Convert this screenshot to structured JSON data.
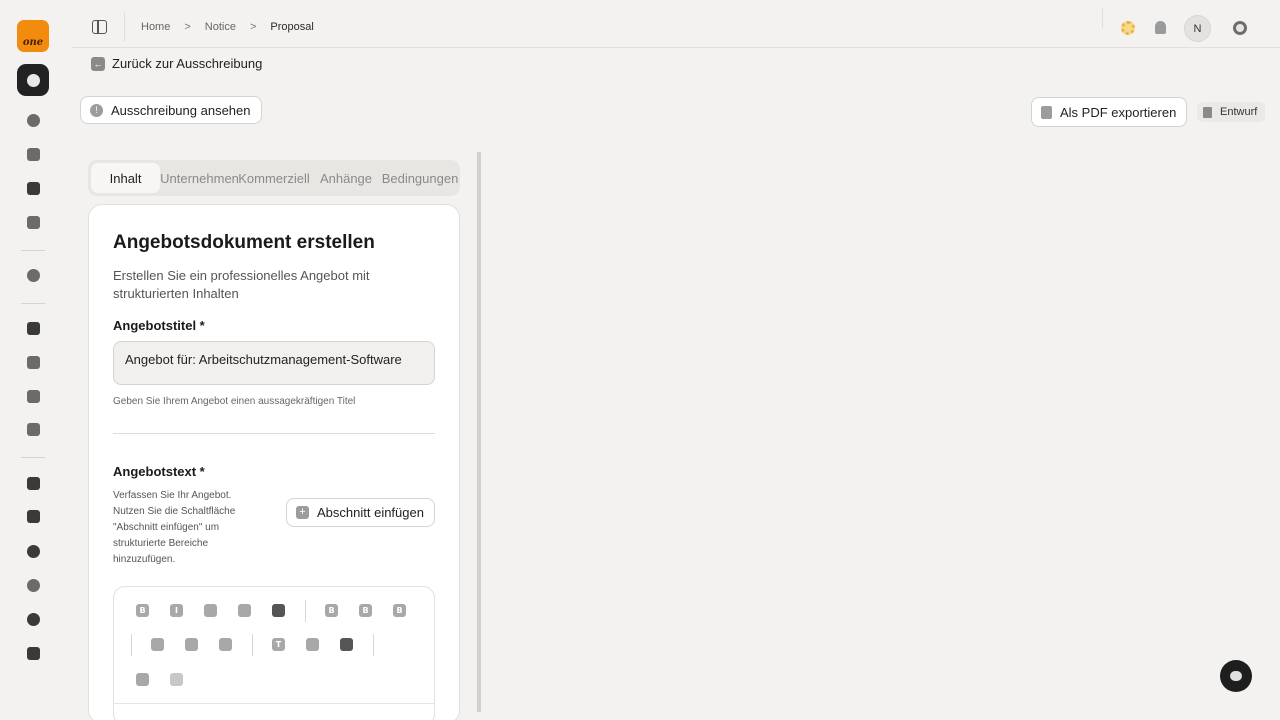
{
  "rail": {
    "logo_text": "one",
    "items": [
      "search-icon",
      "scan-icon",
      "document-icon",
      "buildings-icon",
      "bookmark-icon",
      "target-icon",
      "chip-icon",
      "audio-icon",
      "trend-icon",
      "checklist-icon",
      "user-card-icon",
      "book-icon",
      "chat-icon",
      "bell-icon",
      "team-icon",
      "users-icon"
    ]
  },
  "breadcrumb": {
    "items": [
      "Home",
      "Notice",
      "Proposal"
    ],
    "separator": ">"
  },
  "header": {
    "avatar_initial": "N"
  },
  "page": {
    "back_label": "Zurück zur Ausschreibung",
    "view_tender_label": "Ausschreibung ansehen",
    "export_label": "Als PDF exportieren",
    "status": "Entwurf"
  },
  "tabs": [
    {
      "label": "Inhalt",
      "active": true
    },
    {
      "label": "Unternehmen",
      "active": false
    },
    {
      "label": "Kommerziell",
      "active": false
    },
    {
      "label": "Anhänge",
      "active": false
    },
    {
      "label": "Bedingungen",
      "active": false
    }
  ],
  "form": {
    "title": "Angebotsdokument erstellen",
    "description": "Erstellen Sie ein professionelles Angebot mit strukturierten Inhalten",
    "title_label": "Angebotstitel *",
    "title_value": "Angebot für: Arbeitschutzmanagement-Software",
    "title_hint": "Geben Sie Ihrem Angebot einen aussagekräftigen Titel",
    "text_label": "Angebotstext *",
    "text_description": "Verfassen Sie Ihr Angebot. Nutzen Sie die Schaltfläche \"Abschnitt einfügen\" um strukturierte Bereiche hinzuzufügen.",
    "insert_section_label": "Abschnitt einfügen"
  },
  "editor_toolbar": {
    "row1": [
      "bold",
      "italic",
      "strikethrough",
      "code",
      "highlight",
      "heading-1",
      "heading-2",
      "heading-3"
    ],
    "row2": [
      "bullet-list",
      "ordered-list",
      "task-list",
      "text-format",
      "link",
      "table"
    ],
    "row3": [
      "undo",
      "redo"
    ],
    "heading_glyph": "B",
    "italic_glyph": "I",
    "text_glyph": "T"
  },
  "colors": {
    "brand": "#f28c0f",
    "rail_active": "#222222",
    "background": "#f3f2f0"
  }
}
